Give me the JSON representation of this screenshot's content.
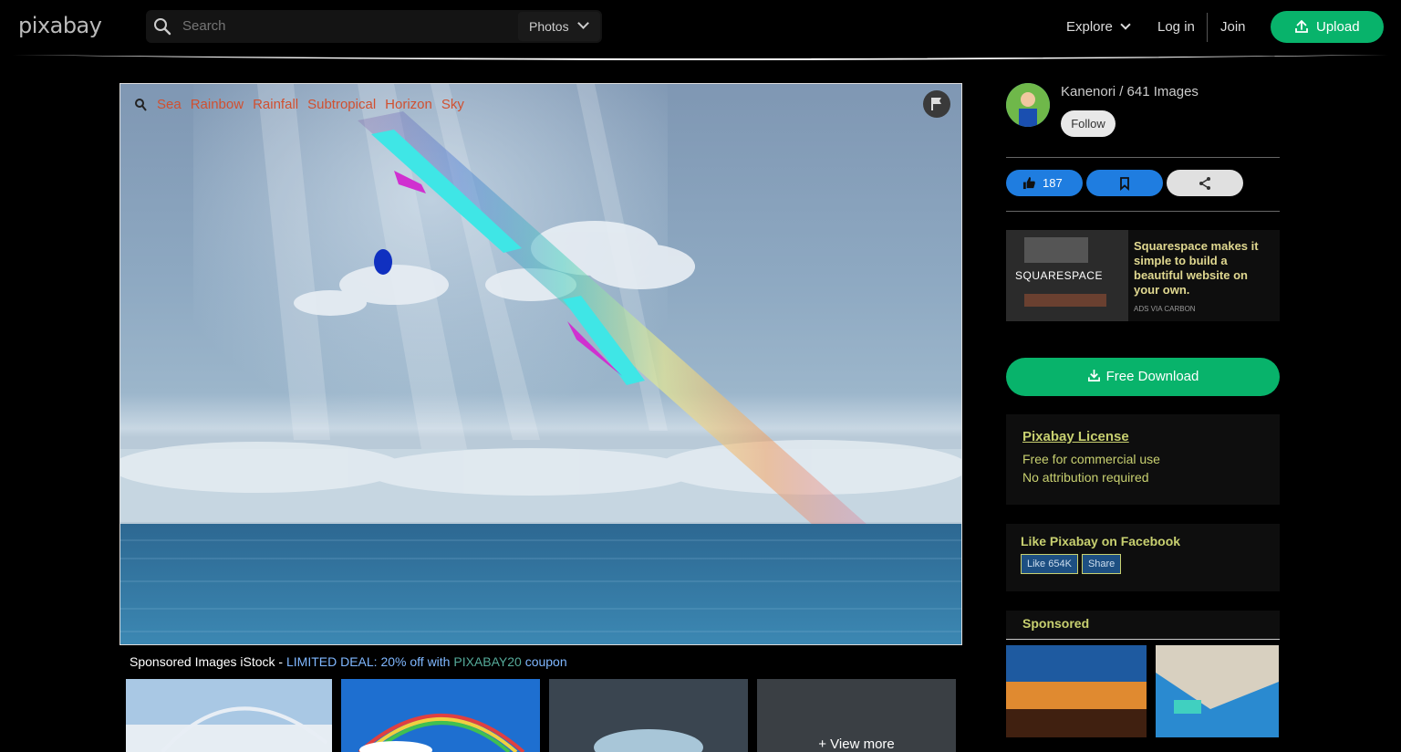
{
  "header": {
    "logo": "pixabay",
    "search_placeholder": "Search",
    "media_filter": "Photos",
    "explore": "Explore",
    "login": "Log in",
    "join": "Join",
    "upload": "Upload"
  },
  "image": {
    "tags": [
      "Sea",
      "Rainbow",
      "Rainfall",
      "Subtropical",
      "Horizon",
      "Sky"
    ],
    "description": ""
  },
  "sponsored": {
    "prefix": "Sponsored Images iStock - ",
    "deal": "LIMITED DEAL: 20% off with ",
    "code": "PIXABAY20",
    "suffix": " coupon",
    "view_more": "+ View more"
  },
  "sidebar": {
    "author": "Kanenori / 641 Images",
    "follow": "Follow",
    "likes": "187",
    "ad": {
      "brand": "SQUARESPACE",
      "text": "Squarespace makes it simple to build a beautiful website on your own.",
      "small": "ADS VIA CARBON"
    },
    "download": "Free Download",
    "license": {
      "title": "Pixabay License",
      "desc": "Free for commercial use No attribution required"
    },
    "facebook": {
      "title": "Like Pixabay on Facebook",
      "like": "Like 654K",
      "share": "Share"
    },
    "sponsored_label": "Sponsored"
  }
}
